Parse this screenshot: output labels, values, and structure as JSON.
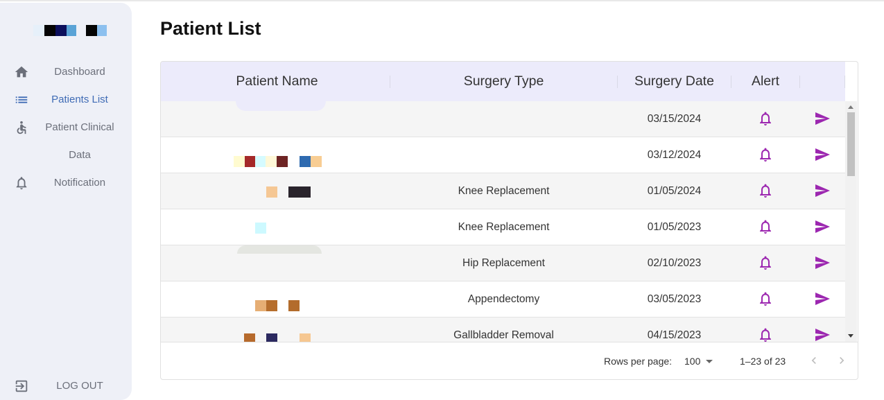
{
  "sidebar": {
    "items": [
      {
        "label": "Dashboard",
        "icon": "home-icon",
        "active": false
      },
      {
        "label": "Patients List",
        "icon": "list-icon",
        "active": true
      },
      {
        "label_line1": "Patient Clinical",
        "label_line2": "Data",
        "icon": "accessible-icon",
        "active": false
      },
      {
        "label": "Notification",
        "icon": "bell-icon",
        "active": false
      }
    ],
    "logout_label": "LOG OUT"
  },
  "page": {
    "title": "Patient List"
  },
  "table": {
    "columns": [
      "Patient Name",
      "Surgery Type",
      "Surgery Date",
      "Alert",
      ""
    ],
    "rows": [
      {
        "patient_name": "",
        "surgery_type": "",
        "surgery_date": "03/15/2024"
      },
      {
        "patient_name": "",
        "surgery_type": "",
        "surgery_date": "03/12/2024"
      },
      {
        "patient_name": "",
        "surgery_type": "Knee Replacement",
        "surgery_date": "01/05/2024"
      },
      {
        "patient_name": "",
        "surgery_type": "Knee Replacement",
        "surgery_date": "01/05/2023"
      },
      {
        "patient_name": "",
        "surgery_type": "Hip Replacement",
        "surgery_date": "02/10/2023"
      },
      {
        "patient_name": "",
        "surgery_type": "Appendectomy",
        "surgery_date": "03/05/2023"
      },
      {
        "patient_name": "",
        "surgery_type": "Gallbladder Removal",
        "surgery_date": "04/15/2023"
      }
    ]
  },
  "pagination": {
    "rows_per_page_label": "Rows per page:",
    "rows_per_page_value": "100",
    "count_text": "1–23 of 23"
  },
  "colors": {
    "accent": "#9c27b0",
    "header_bg": "#ecebfb",
    "sidebar_bg": "#eef0f7",
    "active_nav": "#3f6bb5"
  }
}
